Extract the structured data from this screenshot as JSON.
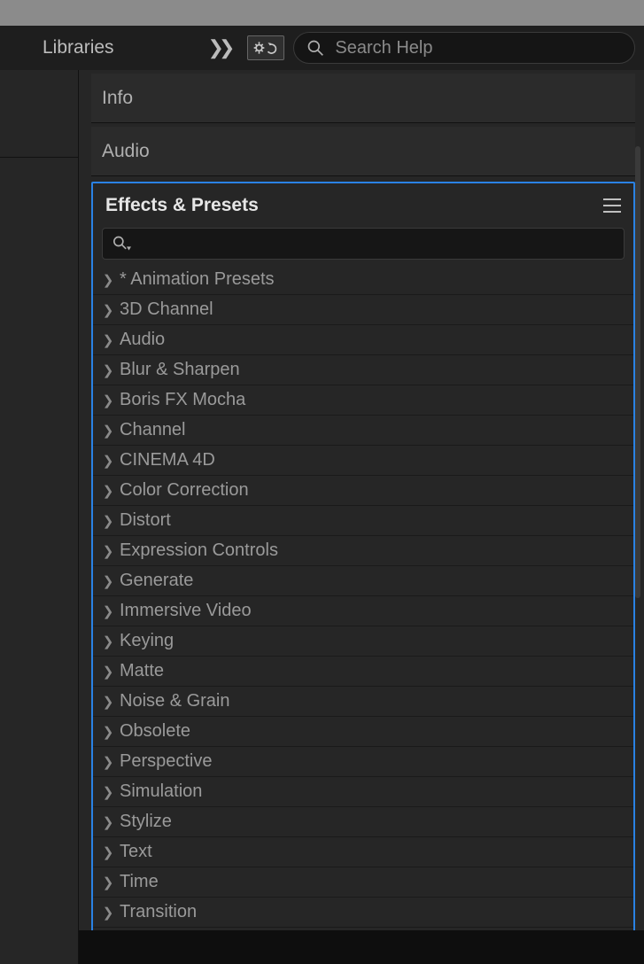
{
  "toolbar": {
    "libraries_tab": "Libraries",
    "search_placeholder": "Search Help"
  },
  "panels": {
    "info_title": "Info",
    "audio_title": "Audio"
  },
  "effects": {
    "title": "Effects & Presets",
    "search_placeholder": "",
    "categories": [
      "* Animation Presets",
      "3D Channel",
      "Audio",
      "Blur & Sharpen",
      "Boris FX Mocha",
      "Channel",
      "CINEMA 4D",
      "Color Correction",
      "Distort",
      "Expression Controls",
      "Generate",
      "Immersive Video",
      "Keying",
      "Matte",
      "Noise & Grain",
      "Obsolete",
      "Perspective",
      "Simulation",
      "Stylize",
      "Text",
      "Time",
      "Transition"
    ]
  }
}
